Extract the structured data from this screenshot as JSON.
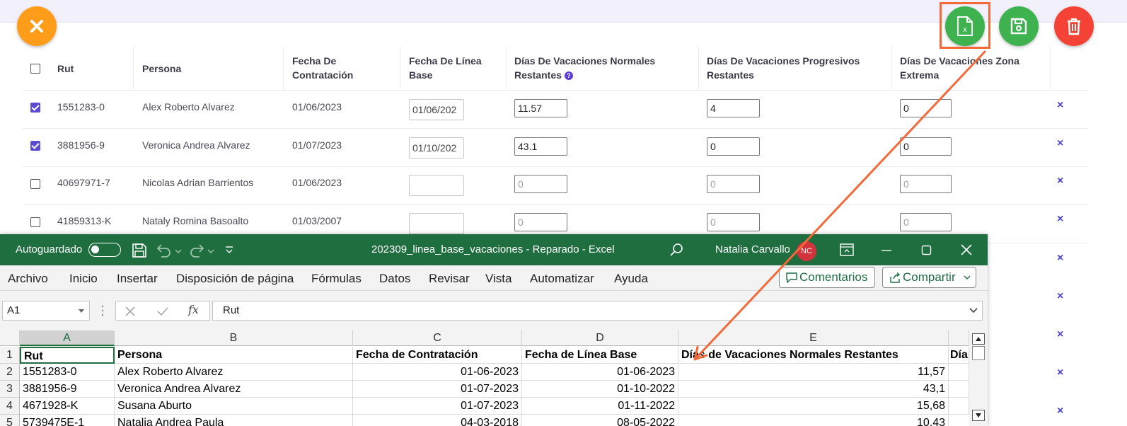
{
  "toolbar": {
    "close_icon": "close-x-icon",
    "excel_icon": "excel-file-icon",
    "save_icon": "floppy-save-icon",
    "delete_icon": "trash-icon"
  },
  "table": {
    "headers": {
      "rut": "Rut",
      "persona": "Persona",
      "fecha_contratacion_1": "Fecha De",
      "fecha_contratacion_2": "Contratación",
      "fecha_linea_1": "Fecha De Línea",
      "fecha_linea_2": "Base",
      "normales_1": "Días De Vacaciones Normales",
      "normales_2": "Restantes",
      "progresivos_1": "Días De Vacaciones Progresivos",
      "progresivos_2": "Restantes",
      "zona_1": "Días De Vacaciones Zona",
      "zona_2": "Extrema",
      "help_icon": "?"
    },
    "rows": [
      {
        "checked": true,
        "rut": "1551283-0",
        "persona": "Alex Roberto Alvarez",
        "fecha_contratacion": "01/06/2023",
        "fecha_linea": "01/06/202",
        "normales": "11.57",
        "progresivos": "4",
        "zona": "0"
      },
      {
        "checked": true,
        "rut": "3881956-9",
        "persona": "Veronica Andrea Alvarez",
        "fecha_contratacion": "01/07/2023",
        "fecha_linea": "01/10/202",
        "normales": "43.1",
        "progresivos": "0",
        "zona": "0"
      },
      {
        "checked": false,
        "rut": "40697971-7",
        "persona": "Nicolas Adrian Barrientos",
        "fecha_contratacion": "01/06/2023",
        "fecha_linea": "",
        "normales": "0",
        "progresivos": "0",
        "zona": "0"
      },
      {
        "checked": false,
        "rut": "41859313-K",
        "persona": "Nataly Romina Basoalto",
        "fecha_contratacion": "01/03/2007",
        "fecha_linea": "",
        "normales": "0",
        "progresivos": "0",
        "zona": "0"
      }
    ],
    "remove_glyph": "×"
  },
  "excel": {
    "autosave_label": "Autoguardado",
    "window_title": "202309_linea_base_vacaciones  -  Reparado  -  Excel",
    "user_name": "Natalia Carvallo",
    "user_initials": "NC",
    "menu": [
      "Archivo",
      "Inicio",
      "Insertar",
      "Disposición de página",
      "Fórmulas",
      "Datos",
      "Revisar",
      "Vista",
      "Automatizar",
      "Ayuda"
    ],
    "comments_label": "Comentarios",
    "share_label": "Compartir",
    "name_box": "A1",
    "formula_value": "Rut",
    "fx_label": "fx",
    "columns": [
      "A",
      "B",
      "C",
      "D",
      "E"
    ],
    "row_numbers": [
      "1",
      "2",
      "3",
      "4",
      "5"
    ],
    "rows": [
      [
        "Rut",
        "Persona",
        "Fecha de Contratación",
        "Fecha de Línea Base",
        "Días de Vacaciones Normales Restantes",
        "Días"
      ],
      [
        "1551283-0",
        "Alex Roberto Alvarez",
        "01-06-2023",
        "01-06-2023",
        "11,57",
        ""
      ],
      [
        "3881956-9",
        "Veronica Andrea Alvarez",
        "01-07-2023",
        "01-10-2022",
        "43,1",
        ""
      ],
      [
        "4671928-K",
        "Susana Aburto",
        "01-07-2023",
        "01-11-2022",
        "15,68",
        ""
      ],
      [
        "5739475E-1",
        "Natalia Andrea Paula",
        "04-03-2018",
        "08-05-2022",
        "10,43",
        ""
      ]
    ]
  },
  "colors": {
    "excel_green": "#1e6e40",
    "orange": "#ff9c1a",
    "green": "#3db24f",
    "red": "#f44336",
    "accent_purple": "#5b4bd1",
    "annotation": "#f26a3a"
  }
}
